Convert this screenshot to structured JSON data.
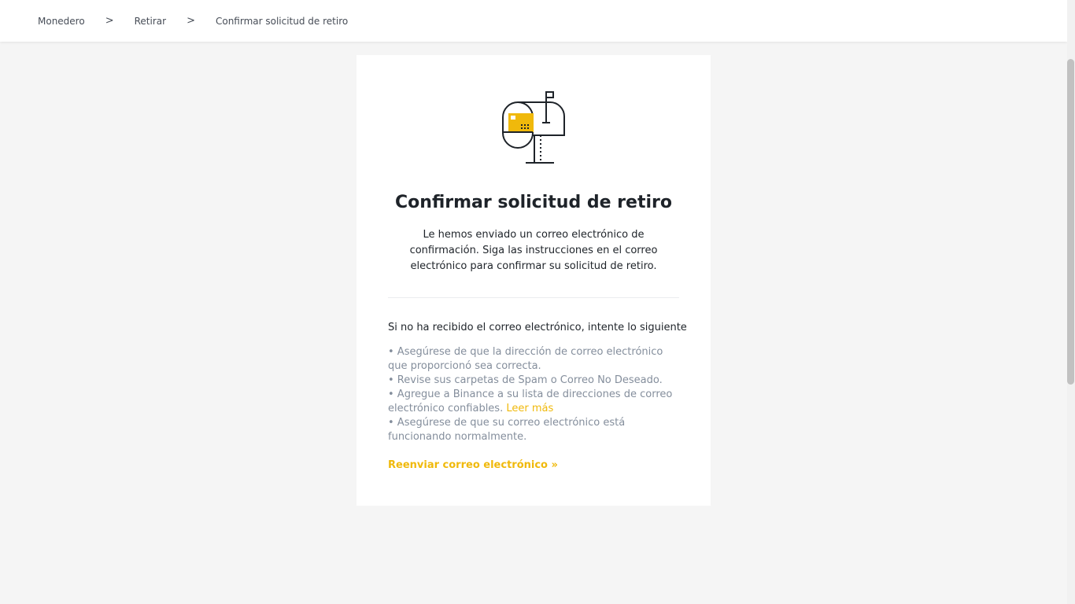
{
  "breadcrumb": {
    "items": [
      "Monedero",
      "Retirar",
      "Confirmar solicitud de retiro"
    ],
    "separator": ">"
  },
  "card": {
    "illustration_icon": "mailbox-icon",
    "title": "Confirmar solicitud de retiro",
    "description": "Le hemos enviado un correo electrónico de confirmación. Siga las instrucciones en el correo electrónico para confirmar su solicitud de retiro.",
    "tips_title": "Si no ha recibido el correo electrónico, intente lo siguiente",
    "tips": [
      "• Asegúrese de que la dirección de correo electrónico que proporcionó sea correcta.",
      "• Revise sus carpetas de Spam o Correo No Deseado.",
      "• Agregue a Binance a su lista de direcciones de correo electrónico confiables.",
      "• Asegúrese de que su correo electrónico está funcionando normalmente."
    ],
    "read_more_label": "Leer más",
    "resend_label": "Reenviar correo electrónico »"
  },
  "colors": {
    "accent": "#f0b90b",
    "text_primary": "#1e2329",
    "text_secondary": "#848e9c",
    "background": "#f5f5f5"
  }
}
